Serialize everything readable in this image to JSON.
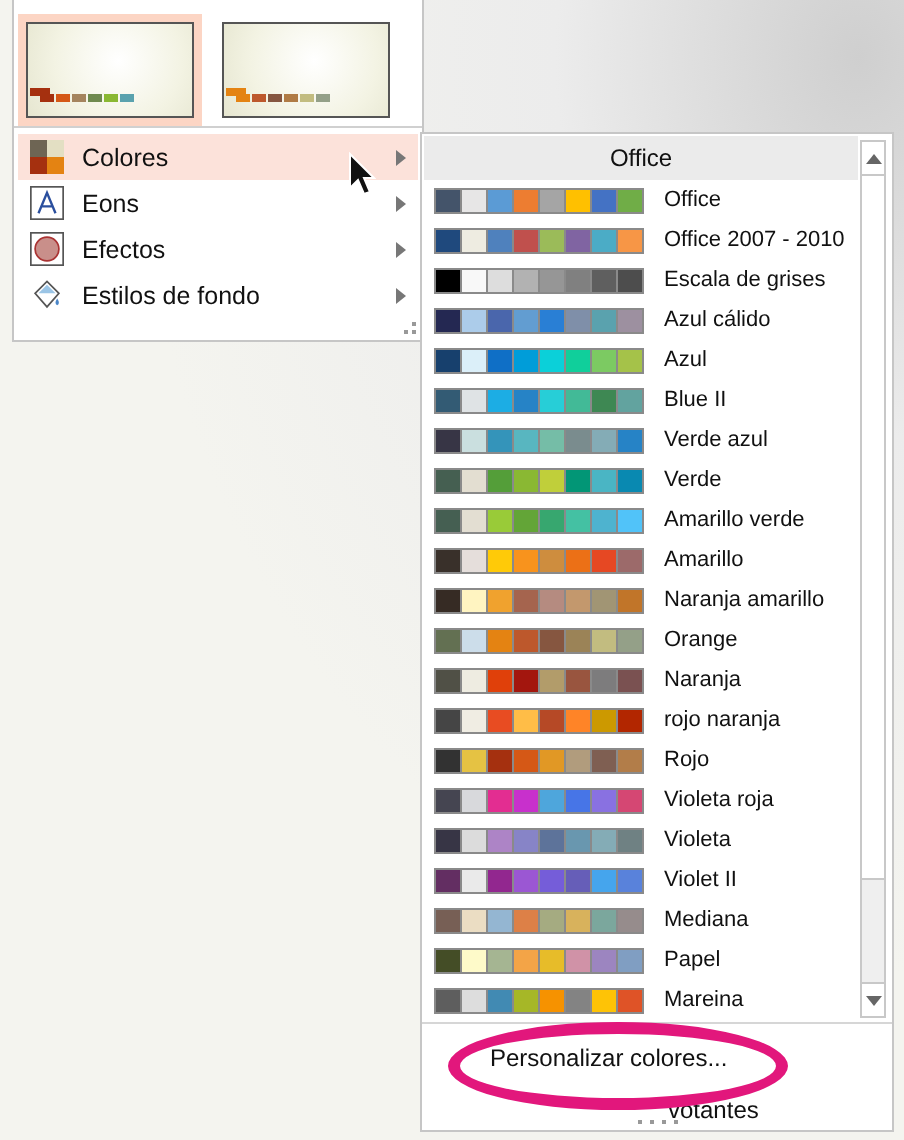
{
  "thumbnails": [
    {
      "selected": true,
      "swatches": [
        {
          "color": "#a5300f"
        },
        {
          "color": "#d55816"
        },
        {
          "color": "#a5845e"
        },
        {
          "color": "#6f8a4f"
        },
        {
          "color": "#8ab833"
        },
        {
          "color": "#5aa2ae"
        }
      ]
    },
    {
      "selected": false,
      "swatches": [
        {
          "color": "#e48312"
        },
        {
          "color": "#bd582c"
        },
        {
          "color": "#865640"
        },
        {
          "color": "#b07b45"
        },
        {
          "color": "#c2bc80"
        },
        {
          "color": "#94a088"
        }
      ]
    }
  ],
  "menu": [
    {
      "label": "Colores",
      "kind": "colors",
      "selected": true
    },
    {
      "label": "Eons",
      "kind": "fonts",
      "selected": false
    },
    {
      "label": "Efectos",
      "kind": "effects",
      "selected": false
    },
    {
      "label": "Estilos de fondo",
      "kind": "background",
      "selected": false
    }
  ],
  "submenu": {
    "header": "Office",
    "themes": [
      {
        "name": "Office",
        "swatches": [
          {
            "color": "#44546a"
          },
          {
            "color": "#e7e6e6"
          },
          {
            "color": "#5b9bd5"
          },
          {
            "color": "#ed7d31"
          },
          {
            "color": "#a5a5a5"
          },
          {
            "color": "#ffc000"
          },
          {
            "color": "#4472c4"
          },
          {
            "color": "#70ad47"
          }
        ]
      },
      {
        "name": "Office 2007 - 2010",
        "swatches": [
          {
            "color": "#1f497d"
          },
          {
            "color": "#eeece1"
          },
          {
            "color": "#4f81bd"
          },
          {
            "color": "#c0504d"
          },
          {
            "color": "#9bbb59"
          },
          {
            "color": "#8064a2"
          },
          {
            "color": "#4bacc6"
          },
          {
            "color": "#f79646"
          }
        ]
      },
      {
        "name": "Escala de grises",
        "swatches": [
          {
            "color": "#000000"
          },
          {
            "color": "#f8f8f8"
          },
          {
            "color": "#dddddd"
          },
          {
            "color": "#b2b2b2"
          },
          {
            "color": "#969696"
          },
          {
            "color": "#808080"
          },
          {
            "color": "#5f5f5f"
          },
          {
            "color": "#4d4d4d"
          }
        ]
      },
      {
        "name": "Azul cálido",
        "swatches": [
          {
            "color": "#242852"
          },
          {
            "color": "#acccea"
          },
          {
            "color": "#4a66ac"
          },
          {
            "color": "#629dd1"
          },
          {
            "color": "#297fd5"
          },
          {
            "color": "#7f8fa9"
          },
          {
            "color": "#5aa2ae"
          },
          {
            "color": "#9d90a0"
          }
        ]
      },
      {
        "name": "Azul",
        "swatches": [
          {
            "color": "#17406d"
          },
          {
            "color": "#dbeff9"
          },
          {
            "color": "#0f6fc6"
          },
          {
            "color": "#009dd9"
          },
          {
            "color": "#0bd0d9"
          },
          {
            "color": "#10cf9b"
          },
          {
            "color": "#7cca62"
          },
          {
            "color": "#a5c249"
          }
        ]
      },
      {
        "name": "Blue II",
        "swatches": [
          {
            "color": "#335b74"
          },
          {
            "color": "#dfe3e5"
          },
          {
            "color": "#1cade4"
          },
          {
            "color": "#2683c6"
          },
          {
            "color": "#27ced7"
          },
          {
            "color": "#42ba97"
          },
          {
            "color": "#3e8853"
          },
          {
            "color": "#62a39f"
          }
        ]
      },
      {
        "name": "Verde azul",
        "swatches": [
          {
            "color": "#373545"
          },
          {
            "color": "#cadfdf"
          },
          {
            "color": "#3494ba"
          },
          {
            "color": "#58b6c0"
          },
          {
            "color": "#75bda7"
          },
          {
            "color": "#7a8c8e"
          },
          {
            "color": "#84acb6"
          },
          {
            "color": "#2683c6"
          }
        ]
      },
      {
        "name": "Verde",
        "swatches": [
          {
            "color": "#455f51"
          },
          {
            "color": "#e3ded1"
          },
          {
            "color": "#549e39"
          },
          {
            "color": "#8ab833"
          },
          {
            "color": "#c0cf3a"
          },
          {
            "color": "#029676"
          },
          {
            "color": "#4ab5c4"
          },
          {
            "color": "#0989b1"
          }
        ]
      },
      {
        "name": "Amarillo verde",
        "swatches": [
          {
            "color": "#455f52"
          },
          {
            "color": "#e3ded2"
          },
          {
            "color": "#99cb38"
          },
          {
            "color": "#63a537"
          },
          {
            "color": "#37a76f"
          },
          {
            "color": "#44c1a3"
          },
          {
            "color": "#4eb3cf"
          },
          {
            "color": "#51c3f9"
          }
        ]
      },
      {
        "name": "Amarillo",
        "swatches": [
          {
            "color": "#39302a"
          },
          {
            "color": "#e5dedb"
          },
          {
            "color": "#ffca08"
          },
          {
            "color": "#f8931d"
          },
          {
            "color": "#ce8d3e"
          },
          {
            "color": "#ec7016"
          },
          {
            "color": "#e64823"
          },
          {
            "color": "#9c6a6a"
          }
        ]
      },
      {
        "name": "Naranja amarillo",
        "swatches": [
          {
            "color": "#362b24"
          },
          {
            "color": "#fff4c1"
          },
          {
            "color": "#f0a22e"
          },
          {
            "color": "#a5644e"
          },
          {
            "color": "#b58b80"
          },
          {
            "color": "#c3986d"
          },
          {
            "color": "#a19574"
          },
          {
            "color": "#c17529"
          }
        ]
      },
      {
        "name": "Orange",
        "swatches": [
          {
            "color": "#637052"
          },
          {
            "color": "#ccddea"
          },
          {
            "color": "#e48312"
          },
          {
            "color": "#bd582c"
          },
          {
            "color": "#865640"
          },
          {
            "color": "#9b8357"
          },
          {
            "color": "#c2bc80"
          },
          {
            "color": "#94a088"
          }
        ]
      },
      {
        "name": "Naranja",
        "swatches": [
          {
            "color": "#505046"
          },
          {
            "color": "#eeece1"
          },
          {
            "color": "#e0400a"
          },
          {
            "color": "#a3160e"
          },
          {
            "color": "#b29c6a"
          },
          {
            "color": "#99553f"
          },
          {
            "color": "#7d7c7d"
          },
          {
            "color": "#7a5151"
          }
        ]
      },
      {
        "name": "rojo naranja",
        "swatches": [
          {
            "color": "#454545"
          },
          {
            "color": "#f0ede3"
          },
          {
            "color": "#e84c22"
          },
          {
            "color": "#ffbd47"
          },
          {
            "color": "#b64926"
          },
          {
            "color": "#ff8427"
          },
          {
            "color": "#cc9900"
          },
          {
            "color": "#b22600"
          }
        ]
      },
      {
        "name": "Rojo",
        "swatches": [
          {
            "color": "#323232"
          },
          {
            "color": "#e5c243"
          },
          {
            "color": "#a5300f"
          },
          {
            "color": "#d55816"
          },
          {
            "color": "#e19825"
          },
          {
            "color": "#b19c7d"
          },
          {
            "color": "#7f5f52"
          },
          {
            "color": "#b27d49"
          }
        ]
      },
      {
        "name": "Violeta roja",
        "swatches": [
          {
            "color": "#454551"
          },
          {
            "color": "#d8d9dc"
          },
          {
            "color": "#e32d91"
          },
          {
            "color": "#c830cc"
          },
          {
            "color": "#4ea6dc"
          },
          {
            "color": "#4775e7"
          },
          {
            "color": "#8971e1"
          },
          {
            "color": "#d54773"
          }
        ]
      },
      {
        "name": "Violeta",
        "swatches": [
          {
            "color": "#373545"
          },
          {
            "color": "#dcdcdc"
          },
          {
            "color": "#ad84c6"
          },
          {
            "color": "#8784c7"
          },
          {
            "color": "#5d739a"
          },
          {
            "color": "#6997af"
          },
          {
            "color": "#84acb6"
          },
          {
            "color": "#6f8183"
          }
        ]
      },
      {
        "name": "Violet II",
        "swatches": [
          {
            "color": "#632e62"
          },
          {
            "color": "#eaeaea"
          },
          {
            "color": "#92278f"
          },
          {
            "color": "#9b57d3"
          },
          {
            "color": "#755dd9"
          },
          {
            "color": "#665eb8"
          },
          {
            "color": "#45a5ed"
          },
          {
            "color": "#5982db"
          }
        ]
      },
      {
        "name": "Mediana",
        "swatches": [
          {
            "color": "#775f55"
          },
          {
            "color": "#ebddc3"
          },
          {
            "color": "#94b6d2"
          },
          {
            "color": "#dd8047"
          },
          {
            "color": "#a5ab81"
          },
          {
            "color": "#d8b25c"
          },
          {
            "color": "#7ba79d"
          },
          {
            "color": "#968c8c"
          }
        ]
      },
      {
        "name": "Papel",
        "swatches": [
          {
            "color": "#444d26"
          },
          {
            "color": "#fefac9"
          },
          {
            "color": "#a5b592"
          },
          {
            "color": "#f3a447"
          },
          {
            "color": "#e7bc29"
          },
          {
            "color": "#d092a7"
          },
          {
            "color": "#9c85c0"
          },
          {
            "color": "#809ec2"
          }
        ]
      },
      {
        "name": "Mareina",
        "swatches": [
          {
            "color": "#5e5e5e"
          },
          {
            "color": "#dddddd"
          },
          {
            "color": "#418ab3"
          },
          {
            "color": "#a6b727"
          },
          {
            "color": "#f69200"
          },
          {
            "color": "#838383"
          },
          {
            "color": "#fec306"
          },
          {
            "color": "#df5327"
          }
        ]
      }
    ],
    "actions": [
      "Personalizar colores...",
      "votantes"
    ]
  }
}
